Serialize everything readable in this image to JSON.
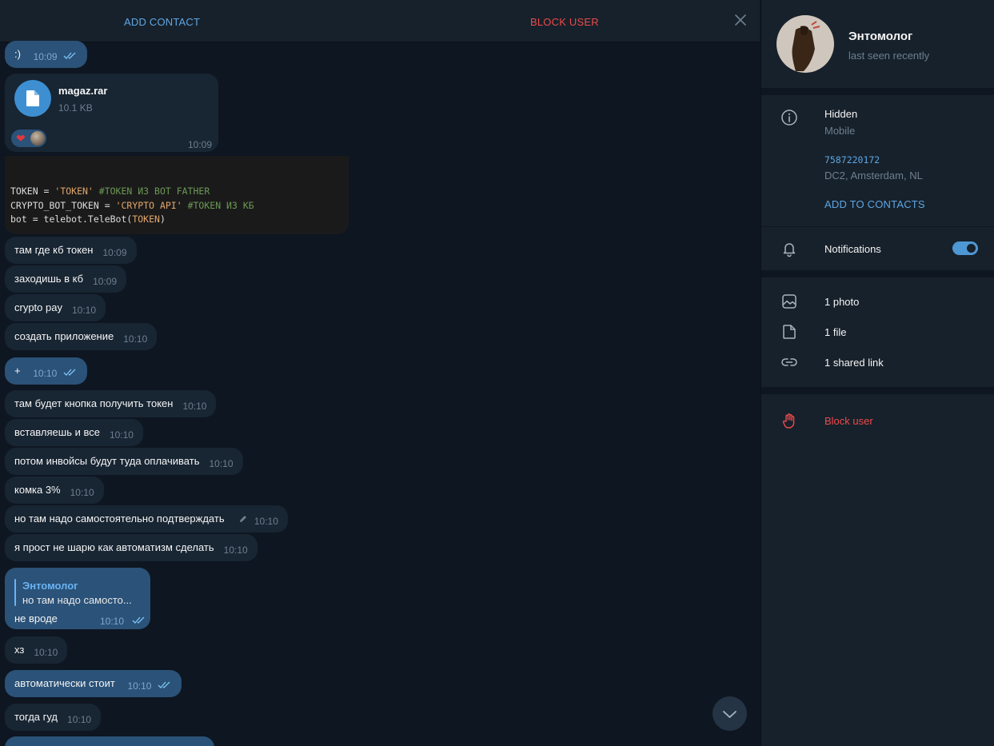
{
  "topbar": {
    "add_contact": "ADD CONTACT",
    "block_user": "BLOCK USER"
  },
  "messages": {
    "smile": {
      "text": ":)",
      "time": "10:09"
    },
    "file": {
      "name": "magaz.rar",
      "size": "10.1 KB",
      "time": "10:09",
      "reaction": "❤"
    },
    "code": {
      "l1_a": "TOKEN = ",
      "l1_b": "'TOKEN'",
      "l1_c": " #TOKEN ИЗ BOT FATHER",
      "l2_a": "CRYPTO_BOT_TOKEN = ",
      "l2_b": "'CRYPTO API'",
      "l2_c": " #TOKEN ИЗ КБ",
      "l3_a": "bot = telebot.TeleBot(",
      "l3_b": "TOKEN",
      "l3_c": ")"
    },
    "m1": {
      "text": "там где кб токен",
      "time": "10:09"
    },
    "m2": {
      "text": "заходишь в кб",
      "time": "10:09"
    },
    "m3": {
      "text": "crypto pay",
      "time": "10:10"
    },
    "m4": {
      "text": "создать приложение",
      "time": "10:10"
    },
    "m5": {
      "text": "+",
      "time": "10:10"
    },
    "m6": {
      "text": "там будет кнопка получить токен",
      "time": "10:10"
    },
    "m7": {
      "text": "вставляешь и все",
      "time": "10:10"
    },
    "m8": {
      "text": "потом инвойсы будут туда оплачивать",
      "time": "10:10"
    },
    "m9": {
      "text": "комка 3%",
      "time": "10:10"
    },
    "m10": {
      "text": "но там надо самостоятельно подтверждать",
      "time": "10:10"
    },
    "m11": {
      "text": "я прост не шарю как автоматизм сделать",
      "time": "10:10"
    },
    "reply": {
      "author": "Энтомолог",
      "quote": "но там надо самосто...",
      "text": "не вроде",
      "time": "10:10"
    },
    "m12": {
      "text": "хз",
      "time": "10:10"
    },
    "m13": {
      "text": "автоматически стоит",
      "time": "10:10"
    },
    "m14": {
      "text": "тогда гуд",
      "time": "10:10"
    }
  },
  "profile": {
    "name": "Энтомолог",
    "status": "last seen recently",
    "info_title": "Hidden",
    "info_sub": "Mobile",
    "user_id": "7587220172",
    "dc": "DC2, Amsterdam, NL",
    "add_to_contacts": "ADD TO CONTACTS",
    "notifications": "Notifications",
    "notifications_on": true,
    "photos": "1 photo",
    "files": "1 file",
    "links": "1 shared link",
    "block": "Block user"
  },
  "colors": {
    "accent": "#5ea6e4",
    "danger": "#ec4a4a",
    "outgoing": "#2b5278",
    "incoming": "#182533",
    "panel": "#17212b",
    "background": "#0e1621"
  }
}
